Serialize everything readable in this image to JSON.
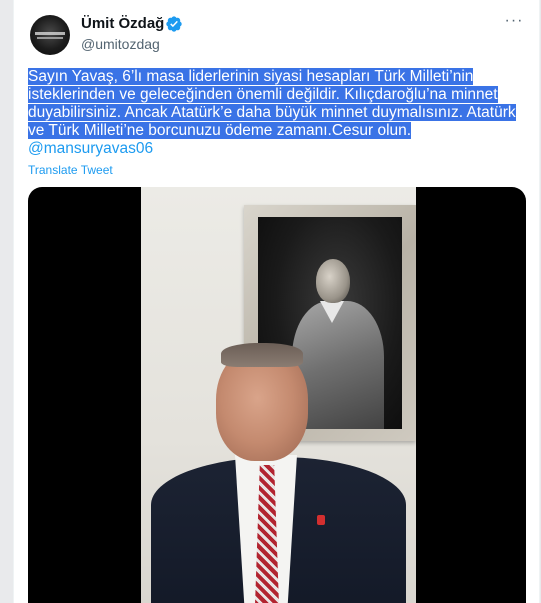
{
  "author": {
    "display_name": "Ümit Özdağ",
    "handle": "@umitozdag",
    "verified_icon": "verified-badge-icon"
  },
  "menu": {
    "more_icon": "more-horizontal-icon",
    "more_label": "···"
  },
  "tweet": {
    "lines": [
      "Sayın Yavaş, 6’lı masa liderlerinin siyasi hesapları Türk Milleti’nin",
      "isteklerinden ve geleceğinden önemli değildir. Kılıçdaroğlu’na minnet",
      "duyabilirsiniz. Ancak Atatürk’e daha büyük minnet duymalısınız. Atatürk",
      "ve Türk Milleti’ne borcunuzu ödeme zamanı.Cesur olun."
    ],
    "mention": "@mansuryavas06",
    "translate": "Translate Tweet"
  },
  "colors": {
    "highlight": "#3a73e6",
    "link": "#1d9bf0",
    "verified": "#1d9bf0"
  }
}
